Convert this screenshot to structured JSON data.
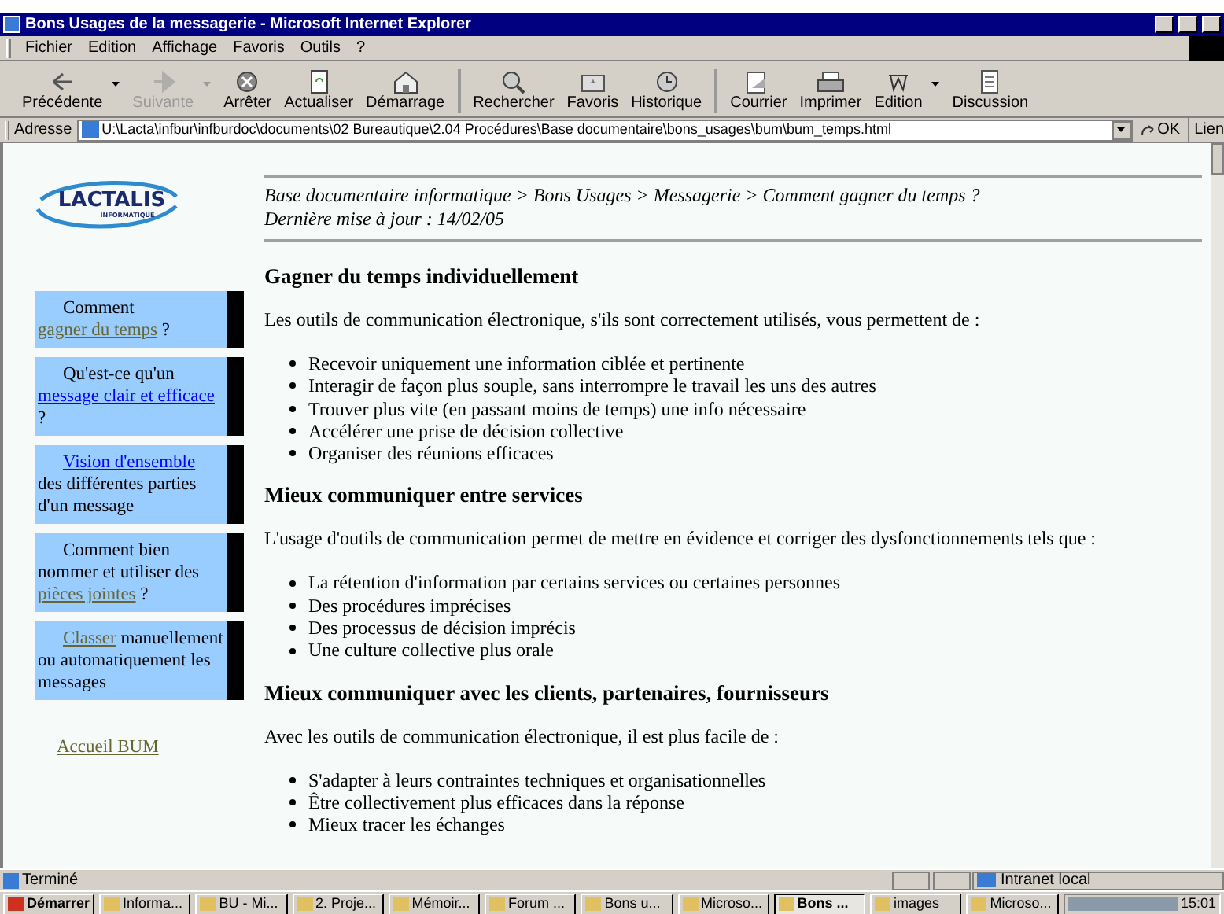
{
  "window": {
    "title": "Bons Usages de la messagerie - Microsoft Internet Explorer"
  },
  "menu": [
    "Fichier",
    "Edition",
    "Affichage",
    "Favoris",
    "Outils",
    "?"
  ],
  "toolbar": [
    {
      "label": "Précédente",
      "kind": "back",
      "disabled": false,
      "dropdown": true
    },
    {
      "label": "Suivante",
      "kind": "forward",
      "disabled": true,
      "dropdown": true
    },
    {
      "label": "Arrêter",
      "kind": "stop",
      "disabled": false,
      "dropdown": false
    },
    {
      "label": "Actualiser",
      "kind": "refresh",
      "disabled": false,
      "dropdown": false
    },
    {
      "label": "Démarrage",
      "kind": "home",
      "disabled": false,
      "dropdown": false
    },
    {
      "label": "Rechercher",
      "kind": "search",
      "disabled": false,
      "dropdown": false,
      "separator_before": true
    },
    {
      "label": "Favoris",
      "kind": "favorites",
      "disabled": false,
      "dropdown": false
    },
    {
      "label": "Historique",
      "kind": "history",
      "disabled": false,
      "dropdown": false
    },
    {
      "label": "Courrier",
      "kind": "mail",
      "disabled": false,
      "dropdown": false,
      "separator_before": true
    },
    {
      "label": "Imprimer",
      "kind": "print",
      "disabled": false,
      "dropdown": false
    },
    {
      "label": "Edition",
      "kind": "edit",
      "disabled": false,
      "dropdown": true
    },
    {
      "label": "Discussion",
      "kind": "discuss",
      "disabled": false,
      "dropdown": false
    }
  ],
  "address": {
    "label": "Adresse",
    "value": "U:\\Lacta\\infbur\\infburdoc\\documents\\02 Bureautique\\2.04 Procédures\\Base documentaire\\bons_usages\\bum\\bum_temps.html",
    "go": "OK",
    "links": "Lien"
  },
  "logo": {
    "name": "LACTALIS",
    "subtitle": "INFORMATIQUE"
  },
  "sidebar": {
    "items": [
      [
        {
          "kind": "text",
          "text": "Comment "
        },
        {
          "kind": "link",
          "text": "gagner du temps",
          "visited": true
        },
        {
          "kind": "text",
          "text": " ?"
        }
      ],
      [
        {
          "kind": "text",
          "text": "Qu'est-ce qu'un "
        },
        {
          "kind": "link",
          "text": "message clair et efficace",
          "visited": false
        },
        {
          "kind": "text",
          "text": " ?"
        }
      ],
      [
        {
          "kind": "link",
          "text": "Vision d'ensemble",
          "visited": false
        },
        {
          "kind": "text",
          "text": " des différentes parties d'un message"
        }
      ],
      [
        {
          "kind": "text",
          "text": "Comment bien nommer et utiliser des "
        },
        {
          "kind": "link",
          "text": "pièces jointes",
          "visited": true
        },
        {
          "kind": "text",
          "text": " ?"
        }
      ],
      [
        {
          "kind": "link",
          "text": "Classer",
          "visited": true
        },
        {
          "kind": "text",
          "text": " manuellement ou automatiquement les messages"
        }
      ]
    ],
    "home_link": {
      "text": "Accueil BUM",
      "visited": true
    }
  },
  "content": {
    "breadcrumb": "Base documentaire informatique > Bons Usages > Messagerie > Comment gagner du temps ?",
    "updated": "Dernière mise à jour : 14/02/05",
    "sections": [
      {
        "heading": "Gagner du temps individuellement",
        "intro": "Les outils de communication électronique, s'ils sont correctement utilisés, vous permettent de :",
        "bullets": [
          "Recevoir uniquement une information ciblée et pertinente",
          "Interagir de façon plus souple, sans interrompre le travail les uns des autres",
          "Trouver plus vite (en passant moins de temps) une info nécessaire",
          "Accélérer une prise de décision collective",
          "Organiser des réunions efficaces"
        ]
      },
      {
        "heading": "Mieux communiquer entre services",
        "intro": "L'usage d'outils de communication permet de mettre en évidence et corriger des dysfonctionnements tels que :",
        "bullets": [
          "La rétention d'information par certains services ou certaines personnes",
          "Des procédures imprécises",
          "Des processus de décision imprécis",
          "Une culture collective plus orale"
        ]
      },
      {
        "heading": "Mieux communiquer avec les clients, partenaires, fournisseurs",
        "intro": "Avec les outils de communication électronique, il est plus facile de :",
        "bullets": [
          "S'adapter à leurs contraintes techniques et organisationnelles",
          "Être collectivement plus efficaces dans la réponse",
          "Mieux tracer les échanges"
        ]
      }
    ]
  },
  "status_bar": {
    "text": "Terminé",
    "zone": "Intranet local"
  },
  "taskbar": {
    "start": "Démarrer",
    "tasks": [
      {
        "label": "Informa...",
        "selected": false
      },
      {
        "label": "BU - Mi...",
        "selected": false
      },
      {
        "label": "2. Proje...",
        "selected": false
      },
      {
        "label": "Mémoir...",
        "selected": false
      },
      {
        "label": "Forum ...",
        "selected": false
      },
      {
        "label": "Bons u...",
        "selected": false
      },
      {
        "label": "Microso...",
        "selected": false
      },
      {
        "label": "Bons ...",
        "selected": true
      },
      {
        "label": "images",
        "selected": false
      },
      {
        "label": "Microso...",
        "selected": false
      }
    ],
    "clock": "15:01"
  }
}
